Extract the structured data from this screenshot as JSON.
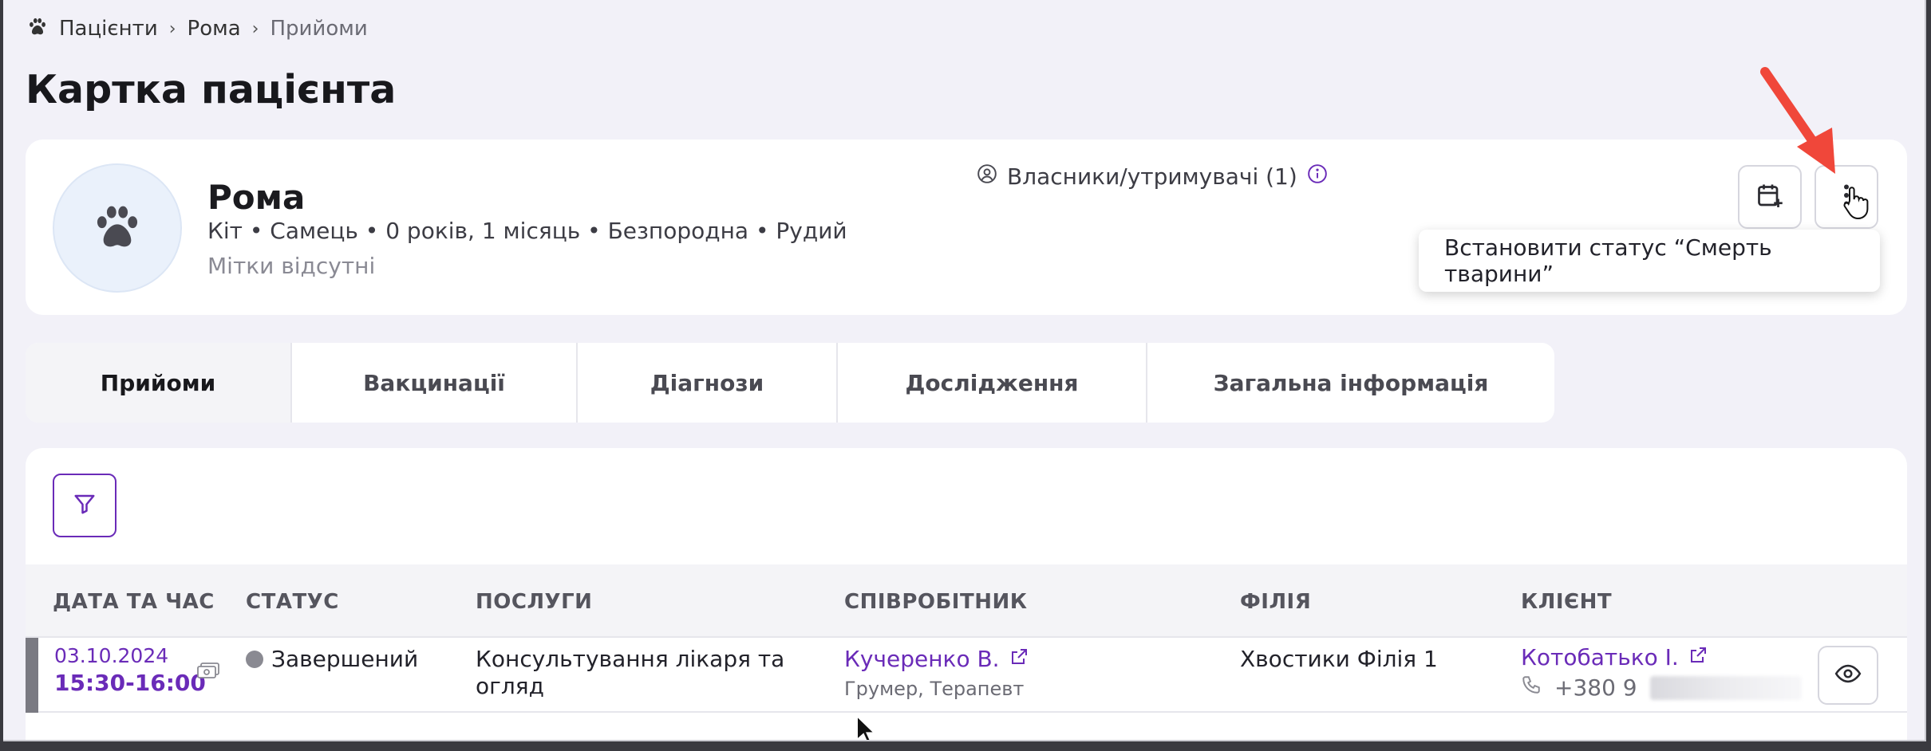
{
  "breadcrumb": {
    "root": "Пацієнти",
    "patient": "Рома",
    "current": "Прийоми"
  },
  "page_title": "Картка пацієнта",
  "patient": {
    "name": "Рома",
    "info": "Кіт • Самець • 0 років, 1 місяць • Безпородна • Рудий",
    "tags": "Мітки відсутні",
    "owners_label": "Власники/утримувачі (1)"
  },
  "menu": {
    "set_death_status": "Встановити статус “Смерть тварини”"
  },
  "tabs": [
    {
      "label": "Прийоми",
      "active": true
    },
    {
      "label": "Вакцинації",
      "active": false
    },
    {
      "label": "Діагнози",
      "active": false
    },
    {
      "label": "Дослідження",
      "active": false
    },
    {
      "label": "Загальна інформація",
      "active": false
    }
  ],
  "table": {
    "columns": [
      "ДАТА ТА ЧАС",
      "СТАТУС",
      "ПОСЛУГИ",
      "СПІВРОБІТНИК",
      "ФІЛІЯ",
      "КЛІЄНТ"
    ],
    "rows": [
      {
        "date": "03.10.2024",
        "time": "15:30-16:00",
        "status": "Завершений",
        "service_line1": "Консультування лікаря та",
        "service_line2": "огляд",
        "employee": "Кучеренко В.",
        "employee_role": "Грумер, Терапевт",
        "branch": "Хвостики Філія 1",
        "client": "Котобатько І.",
        "client_phone": "+380 9"
      }
    ]
  },
  "icons": {
    "breadcrumb": "paw-icon",
    "avatar": "paw-icon",
    "owners": "user-circle-icon",
    "info": "info-icon",
    "calendar": "calendar-plus-icon",
    "more": "more-vertical-icon",
    "filter": "filter-icon",
    "cash": "cash-icon",
    "external": "external-link-icon",
    "phone": "phone-icon",
    "view": "eye-icon",
    "annotation": "red-arrow-icon"
  },
  "colors": {
    "accent": "#6a2bb8",
    "background": "#f2f1f8",
    "annotation_arrow": "#f0473a",
    "status_completed": "#8a8a92"
  }
}
